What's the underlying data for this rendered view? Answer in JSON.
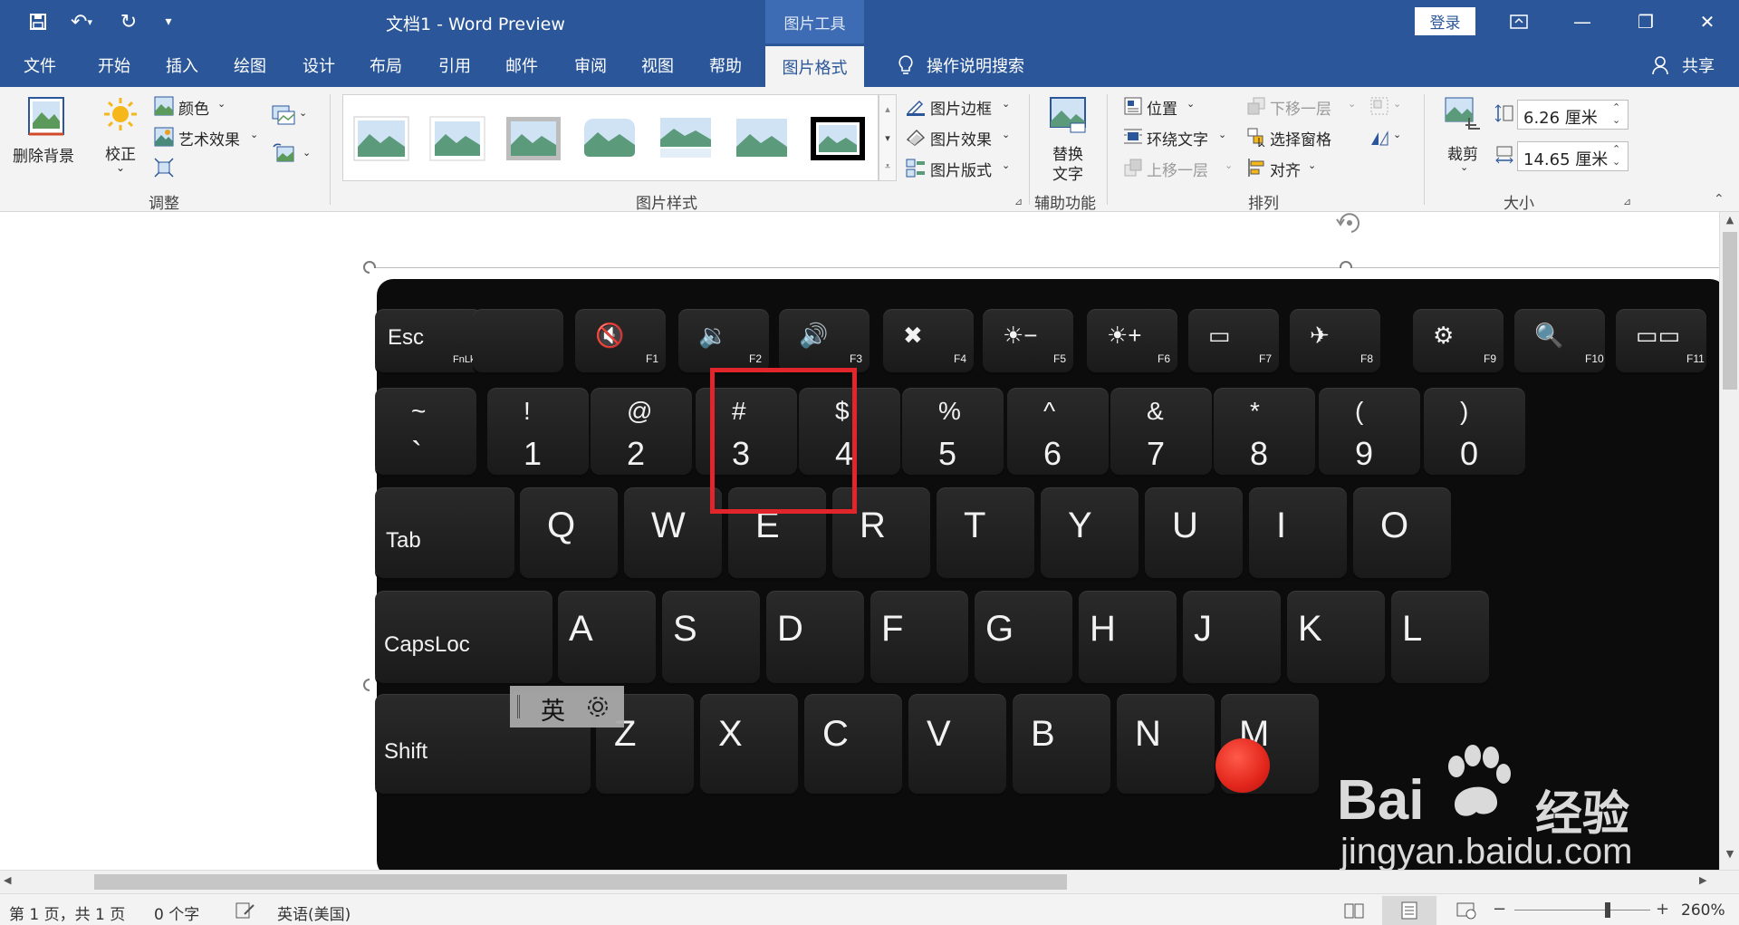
{
  "titlebar": {
    "title": "文档1  -  Word Preview",
    "context_tab_title": "图片工具",
    "login": "登录"
  },
  "tabs": [
    {
      "label": "文件"
    },
    {
      "label": "开始"
    },
    {
      "label": "插入"
    },
    {
      "label": "绘图"
    },
    {
      "label": "设计"
    },
    {
      "label": "布局"
    },
    {
      "label": "引用"
    },
    {
      "label": "邮件"
    },
    {
      "label": "审阅"
    },
    {
      "label": "视图"
    },
    {
      "label": "帮助"
    },
    {
      "label": "图片格式"
    }
  ],
  "tell_me": "操作说明搜索",
  "share": "共享",
  "ribbon": {
    "remove_bg": "删除背景",
    "corrections": "校正",
    "color": "颜色",
    "artistic": "艺术效果",
    "group_adjust": "调整",
    "group_styles": "图片样式",
    "border": "图片边框",
    "effects": "图片效果",
    "layout": "图片版式",
    "alt_text_1": "替换",
    "alt_text_2": "文字",
    "group_access": "辅助功能",
    "position": "位置",
    "wrap_text": "环绕文字",
    "bring_forward": "上移一层",
    "send_backward": "下移一层",
    "selection_pane": "选择窗格",
    "align": "对齐",
    "group_arrange": "排列",
    "crop": "裁剪",
    "height": "6.26 厘米",
    "width": "14.65 厘米",
    "group_size": "大小"
  },
  "keyboard": {
    "fn_row": [
      "Esc",
      "FnLk",
      "F1",
      "F2",
      "F3",
      "F4",
      "F5",
      "F6",
      "F7",
      "F8",
      "F9",
      "F10",
      "F11"
    ],
    "num_row": [
      {
        "top": "~",
        "bottom": "`"
      },
      {
        "top": "!",
        "bottom": "1"
      },
      {
        "top": "@",
        "bottom": "2"
      },
      {
        "top": "#",
        "bottom": "3"
      },
      {
        "top": "$",
        "bottom": "4"
      },
      {
        "top": "%",
        "bottom": "5"
      },
      {
        "top": "^",
        "bottom": "6"
      },
      {
        "top": "&",
        "bottom": "7"
      },
      {
        "top": "*",
        "bottom": "8"
      },
      {
        "top": "(",
        "bottom": "9"
      },
      {
        "top": ")",
        "bottom": "0"
      }
    ],
    "tab": "Tab",
    "q_row": [
      "Q",
      "W",
      "E",
      "R",
      "T",
      "Y",
      "U",
      "I",
      "O"
    ],
    "capslock": "CapsLoc",
    "a_row": [
      "A",
      "S",
      "D",
      "F",
      "G",
      "H",
      "J",
      "K",
      "L"
    ],
    "shift": "Shift",
    "z_row": [
      "Z",
      "X",
      "C",
      "V",
      "B",
      "N",
      "M"
    ]
  },
  "ime": {
    "label": "英"
  },
  "watermark": {
    "brand": "Bai",
    "brand2": "经验",
    "url": "jingyan.baidu.com"
  },
  "status": {
    "page": "第 1 页，共 1 页",
    "words": "0 个字",
    "language": "英语(美国)",
    "zoom": "260%"
  }
}
